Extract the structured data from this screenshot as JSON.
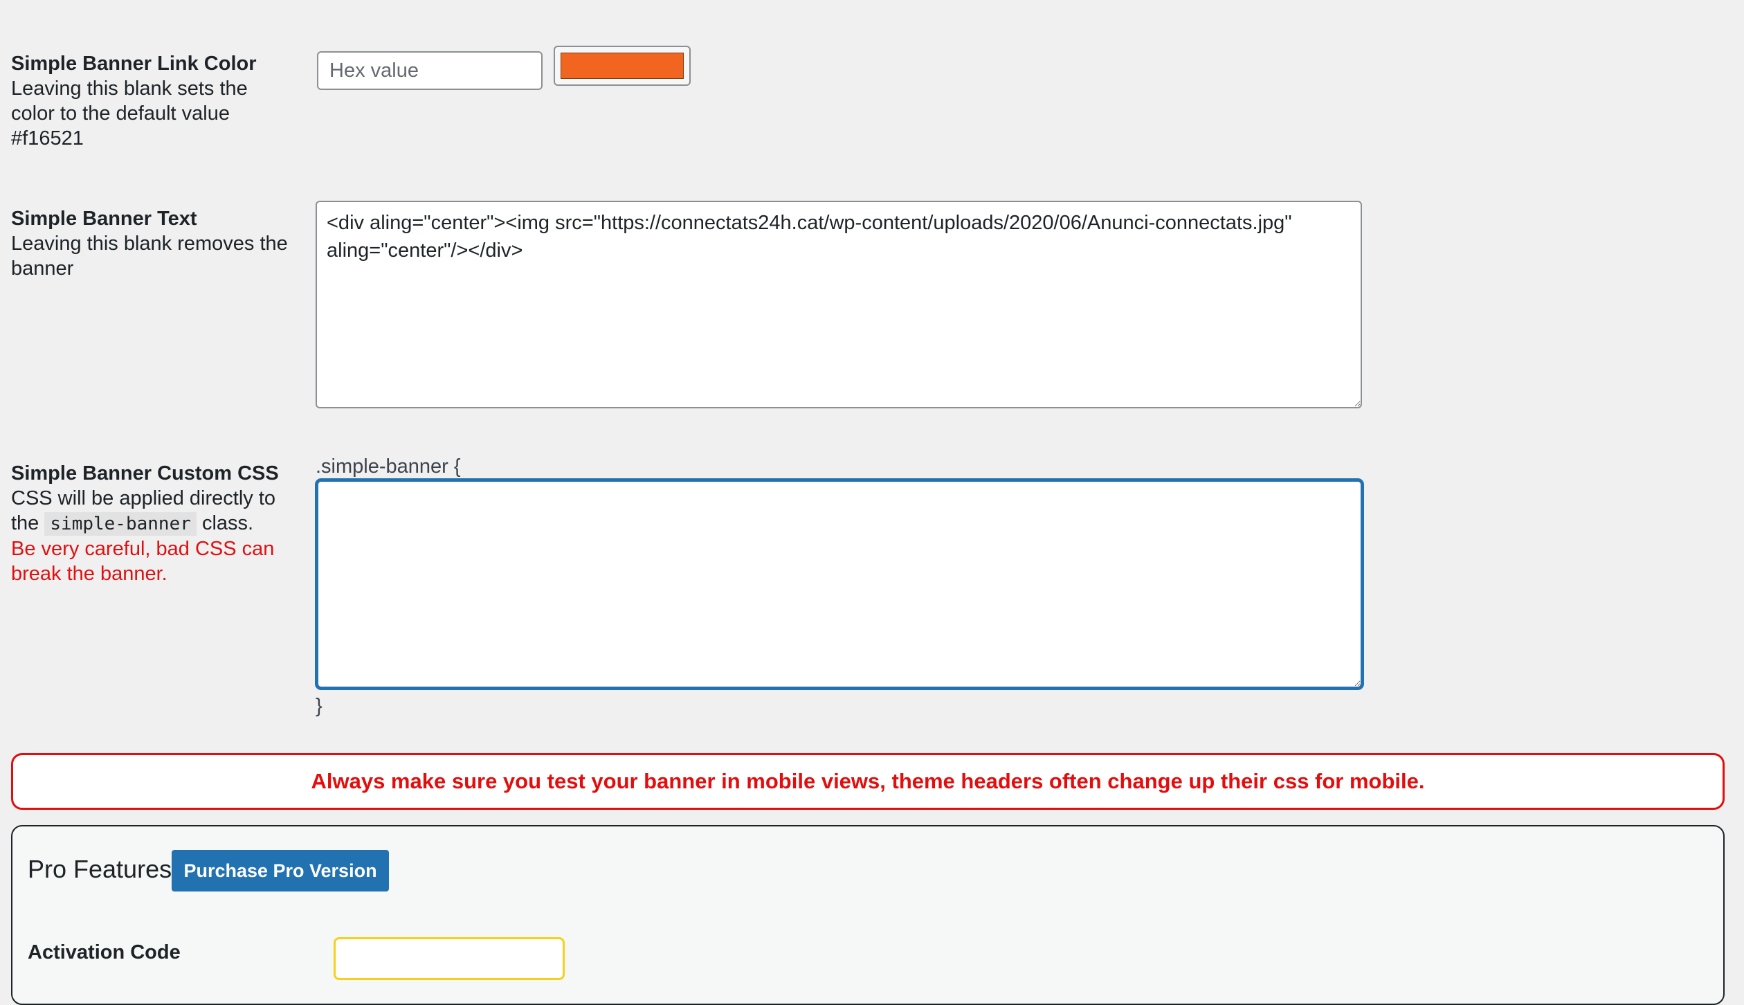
{
  "link_color": {
    "title": "Simple Banner Link Color",
    "description": "Leaving this blank sets the color to the default value #f16521",
    "placeholder": "Hex value",
    "value": "",
    "swatch_color": "#f16521"
  },
  "banner_text": {
    "title": "Simple Banner Text",
    "description": "Leaving this blank removes the banner",
    "value": "<div aling=\"center\"><img src=\"https://connectats24h.cat/wp-content/uploads/2020/06/Anunci-connectats.jpg\" aling=\"center\"/></div>"
  },
  "custom_css": {
    "title": "Simple Banner Custom CSS",
    "description_prefix": "CSS will be applied directly to the",
    "class_name": "simple-banner",
    "description_suffix": "class.",
    "warning": "Be very careful, bad CSS can break the banner.",
    "open_selector": ".simple-banner {",
    "close_brace": "}",
    "value": ""
  },
  "mobile_warning": "Always make sure you test your banner in mobile views, theme headers often change up their css for mobile.",
  "pro": {
    "title": "Pro Features",
    "purchase_label": "Purchase Pro Version",
    "activation_label": "Activation Code",
    "activation_value": ""
  },
  "colors": {
    "accent": "#2271b1",
    "warning_red": "#e30d0d",
    "activation_border": "#f5d11d",
    "swatch": "#f16521"
  }
}
